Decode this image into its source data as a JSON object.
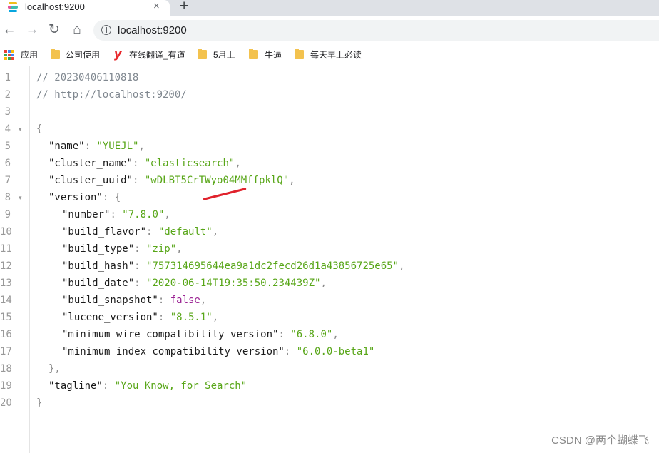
{
  "tab": {
    "title": "localhost:9200",
    "close_glyph": "×",
    "new_tab_glyph": "+"
  },
  "toolbar": {
    "back": "←",
    "forward": "→",
    "reload": "↻",
    "home": "⌂",
    "url": "localhost:9200"
  },
  "bookmarks": [
    {
      "label": "应用",
      "icon": "apps-icon"
    },
    {
      "label": "公司使用",
      "icon": "folder-icon"
    },
    {
      "label": "在线翻译_有道",
      "icon": "youdao-icon"
    },
    {
      "label": "5月上",
      "icon": "folder-icon"
    },
    {
      "label": "牛逼",
      "icon": "folder-icon"
    },
    {
      "label": "每天早上必读",
      "icon": "folder-icon"
    }
  ],
  "json_view": {
    "comment_timestamp": "// 20230406110818",
    "comment_url": "// http://localhost:9200/",
    "open_brace": "{",
    "close_brace": "}",
    "version_close": "},",
    "fields": {
      "name": {
        "key": "\"name\"",
        "value": "\"YUEJL\""
      },
      "cluster_name": {
        "key": "\"cluster_name\"",
        "value": "\"elasticsearch\""
      },
      "cluster_uuid": {
        "key": "\"cluster_uuid\"",
        "value": "\"wDLBT5CrTWyo04MMffpklQ\""
      },
      "version": {
        "key": "\"version\"",
        "value": "{"
      },
      "number": {
        "key": "\"number\"",
        "value": "\"7.8.0\""
      },
      "build_flavor": {
        "key": "\"build_flavor\"",
        "value": "\"default\""
      },
      "build_type": {
        "key": "\"build_type\"",
        "value": "\"zip\""
      },
      "build_hash": {
        "key": "\"build_hash\"",
        "value": "\"757314695644ea9a1dc2fecd26d1a43856725e65\""
      },
      "build_date": {
        "key": "\"build_date\"",
        "value": "\"2020-06-14T19:35:50.234439Z\""
      },
      "build_snapshot": {
        "key": "\"build_snapshot\"",
        "value": "false"
      },
      "lucene_version": {
        "key": "\"lucene_version\"",
        "value": "\"8.5.1\""
      },
      "minimum_wire_compatibility_version": {
        "key": "\"minimum_wire_compatibility_version\"",
        "value": "\"6.8.0\""
      },
      "minimum_index_compatibility_version": {
        "key": "\"minimum_index_compatibility_version\"",
        "value": "\"6.0.0-beta1\""
      },
      "tagline": {
        "key": "\"tagline\"",
        "value": "\"You Know, for Search\""
      }
    },
    "line_numbers": [
      "1",
      "2",
      "3",
      "4",
      "5",
      "6",
      "7",
      "8",
      "9",
      "10",
      "11",
      "12",
      "13",
      "14",
      "15",
      "16",
      "17",
      "18",
      "19",
      "20"
    ],
    "fold_glyph": "▾"
  },
  "watermark": "CSDN @两个蝴蝶飞",
  "colors": {
    "string": "#58a618",
    "boolean": "#9b2393",
    "annotation": "#e0222c"
  }
}
